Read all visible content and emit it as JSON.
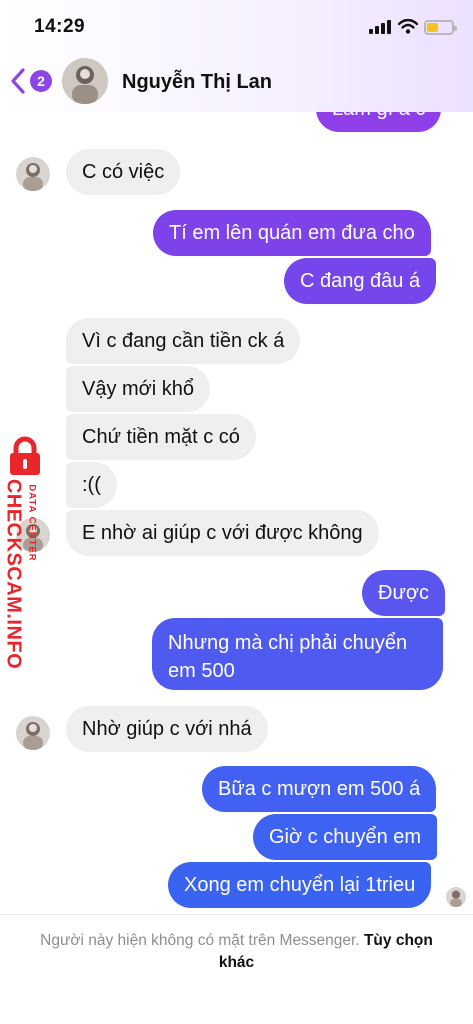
{
  "status_bar": {
    "time": "14:29"
  },
  "header": {
    "back_badge": "2",
    "contact_name": "Nguyễn Thị Lan"
  },
  "messages": [
    {
      "side": "out",
      "text": "Làm gì á c"
    },
    {
      "side": "in",
      "text": "C có việc"
    },
    {
      "side": "out",
      "text": "Tí em lên quán em đưa cho"
    },
    {
      "side": "out",
      "text": "C đang đâu á"
    },
    {
      "side": "in",
      "text": "Vì c đang cần tiền ck á"
    },
    {
      "side": "in",
      "text": "Vậy mới khổ"
    },
    {
      "side": "in",
      "text": "Chứ tiền mặt c có"
    },
    {
      "side": "in",
      "text": ":(("
    },
    {
      "side": "in",
      "text": "E nhờ ai giúp c với được không"
    },
    {
      "side": "out",
      "text": "Được"
    },
    {
      "side": "out",
      "text": "Nhưng mà chị phải chuyển em 500",
      "lines": [
        "Nhưng mà chị phải chuyển",
        "em 500"
      ]
    },
    {
      "side": "in",
      "text": "Nhờ giúp c với nhá"
    },
    {
      "side": "out",
      "text": "Bữa c mượn em 500 á"
    },
    {
      "side": "out",
      "text": "Giờ c chuyển em"
    },
    {
      "side": "out",
      "text": "Xong em chuyển lại 1trieu"
    }
  ],
  "footer": {
    "notice": "Người này hiện không có mặt trên Messenger.",
    "link": "Tùy chọn khác"
  },
  "watermark": {
    "main": "CHECKSCAM.INFO",
    "sub": "DATA CENTER"
  },
  "colors": {
    "outgoing_top": "#8f3fe8",
    "outgoing_bottom": "#3a63f2",
    "incoming": "#efefef",
    "badge": "#8a46e6",
    "watermark": "#e8262b"
  },
  "icons": [
    "back-chevron-icon",
    "signal-icon",
    "wifi-icon",
    "battery-icon",
    "lock-icon"
  ]
}
